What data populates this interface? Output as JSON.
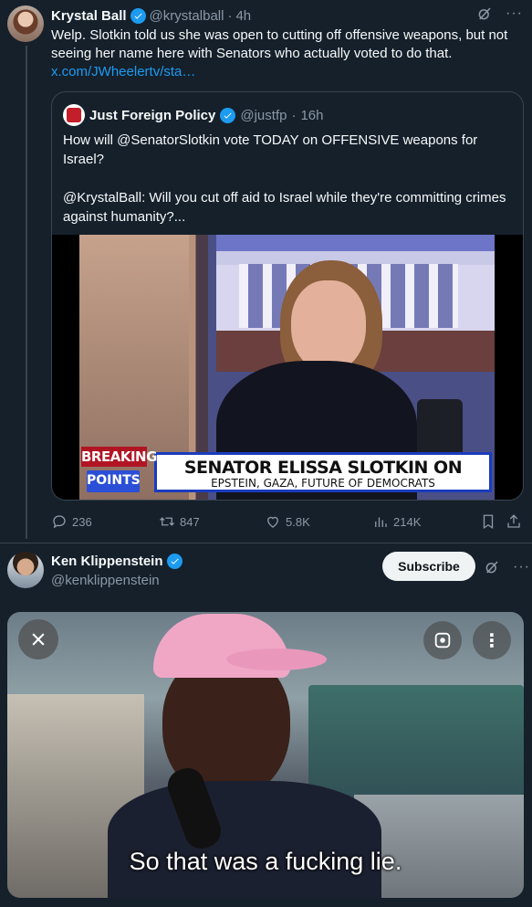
{
  "tweet1": {
    "name": "Krystal Ball",
    "handle": "@krystalball",
    "dot": "·",
    "time": "4h",
    "text": "Welp. Slotkin told us  she was open to cutting off offensive weapons, but not seeing her name here with Senators who actually voted to do that.",
    "link": "x.com/JWheelertv/sta…",
    "more": "···",
    "quote": {
      "name": "Just Foreign Policy",
      "handle": "@justfp",
      "dot": "·",
      "time": "16h",
      "text": "How will @SenatorSlotkin vote TODAY on OFFENSIVE weapons for Israel?\n\n@KrystalBall: Will you cut off aid to Israel while they're committing crimes against humanity?...",
      "video": {
        "breaking": "BREAKING",
        "points": "POINTS",
        "chyron_line1": "SENATOR ELISSA SLOTKIN ON",
        "chyron_line2": "EPSTEIN, GAZA, FUTURE OF DEMOCRATS"
      }
    },
    "actions": {
      "replies": "236",
      "reposts": "847",
      "likes": "5.8K",
      "views": "214K"
    }
  },
  "tweet2": {
    "name": "Ken Klippenstein",
    "handle": "@kenklippenstein",
    "subscribe_label": "Subscribe",
    "more": "···",
    "media": {
      "subtitle": "So that was a fucking lie.",
      "more": "⋮"
    }
  },
  "colors": {
    "background": "#15202b",
    "accent": "#1d9bf0",
    "text_secondary": "#8b98a5",
    "border": "#38444d"
  },
  "icons": [
    "verified-icon",
    "grok-icon",
    "more-icon",
    "reply-icon",
    "retweet-icon",
    "like-icon",
    "views-icon",
    "bookmark-icon",
    "share-icon",
    "close-icon",
    "lens-icon"
  ]
}
